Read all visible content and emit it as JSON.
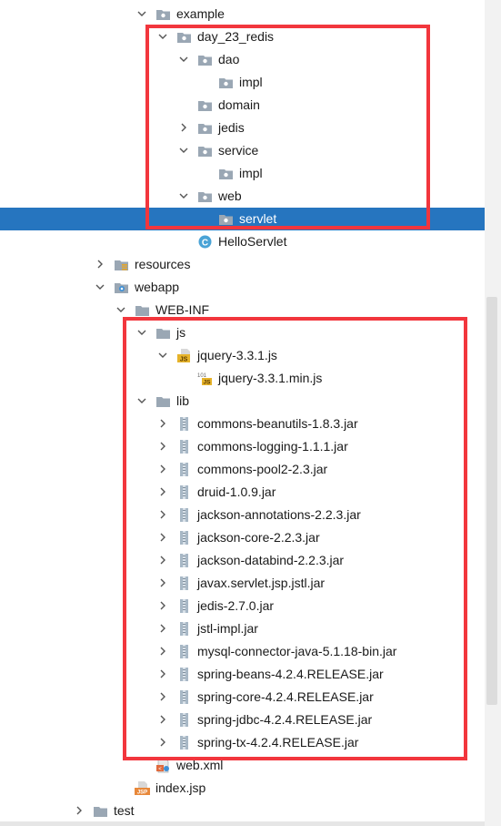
{
  "colors": {
    "selection": "#2675bf",
    "highlight_box": "#f2363d",
    "folder": "#8f9aa6"
  },
  "tree": [
    {
      "label": "example",
      "depth": 6,
      "arrow": "down",
      "icon": "package-folder-icon"
    },
    {
      "label": "day_23_redis",
      "depth": 7,
      "arrow": "down",
      "icon": "package-folder-icon"
    },
    {
      "label": "dao",
      "depth": 8,
      "arrow": "down",
      "icon": "package-folder-icon"
    },
    {
      "label": "impl",
      "depth": 9,
      "arrow": "none",
      "icon": "package-folder-icon"
    },
    {
      "label": "domain",
      "depth": 8,
      "arrow": "none",
      "icon": "package-folder-icon"
    },
    {
      "label": "jedis",
      "depth": 8,
      "arrow": "right",
      "icon": "package-folder-icon"
    },
    {
      "label": "service",
      "depth": 8,
      "arrow": "down",
      "icon": "package-folder-icon"
    },
    {
      "label": "impl",
      "depth": 9,
      "arrow": "none",
      "icon": "package-folder-icon"
    },
    {
      "label": "web",
      "depth": 8,
      "arrow": "down",
      "icon": "package-folder-icon"
    },
    {
      "label": "servlet",
      "depth": 9,
      "arrow": "none",
      "icon": "package-folder-icon",
      "selected": true
    },
    {
      "label": "HelloServlet",
      "depth": 8,
      "arrow": "none",
      "icon": "java-class-icon"
    },
    {
      "label": "resources",
      "depth": 4,
      "arrow": "right",
      "icon": "resources-folder-icon"
    },
    {
      "label": "webapp",
      "depth": 4,
      "arrow": "down",
      "icon": "web-folder-icon"
    },
    {
      "label": "WEB-INF",
      "depth": 5,
      "arrow": "down",
      "icon": "folder-icon"
    },
    {
      "label": "js",
      "depth": 6,
      "arrow": "down",
      "icon": "folder-icon"
    },
    {
      "label": "jquery-3.3.1.js",
      "depth": 7,
      "arrow": "down",
      "icon": "js-file-icon"
    },
    {
      "label": "jquery-3.3.1.min.js",
      "depth": 8,
      "arrow": "none",
      "icon": "minified-js-file-icon"
    },
    {
      "label": "lib",
      "depth": 6,
      "arrow": "down",
      "icon": "folder-icon"
    },
    {
      "label": "commons-beanutils-1.8.3.jar",
      "depth": 7,
      "arrow": "right",
      "icon": "jar-file-icon"
    },
    {
      "label": "commons-logging-1.1.1.jar",
      "depth": 7,
      "arrow": "right",
      "icon": "jar-file-icon"
    },
    {
      "label": "commons-pool2-2.3.jar",
      "depth": 7,
      "arrow": "right",
      "icon": "jar-file-icon"
    },
    {
      "label": "druid-1.0.9.jar",
      "depth": 7,
      "arrow": "right",
      "icon": "jar-file-icon"
    },
    {
      "label": "jackson-annotations-2.2.3.jar",
      "depth": 7,
      "arrow": "right",
      "icon": "jar-file-icon"
    },
    {
      "label": "jackson-core-2.2.3.jar",
      "depth": 7,
      "arrow": "right",
      "icon": "jar-file-icon"
    },
    {
      "label": "jackson-databind-2.2.3.jar",
      "depth": 7,
      "arrow": "right",
      "icon": "jar-file-icon"
    },
    {
      "label": "javax.servlet.jsp.jstl.jar",
      "depth": 7,
      "arrow": "right",
      "icon": "jar-file-icon"
    },
    {
      "label": "jedis-2.7.0.jar",
      "depth": 7,
      "arrow": "right",
      "icon": "jar-file-icon"
    },
    {
      "label": "jstl-impl.jar",
      "depth": 7,
      "arrow": "right",
      "icon": "jar-file-icon"
    },
    {
      "label": "mysql-connector-java-5.1.18-bin.jar",
      "depth": 7,
      "arrow": "right",
      "icon": "jar-file-icon"
    },
    {
      "label": "spring-beans-4.2.4.RELEASE.jar",
      "depth": 7,
      "arrow": "right",
      "icon": "jar-file-icon"
    },
    {
      "label": "spring-core-4.2.4.RELEASE.jar",
      "depth": 7,
      "arrow": "right",
      "icon": "jar-file-icon"
    },
    {
      "label": "spring-jdbc-4.2.4.RELEASE.jar",
      "depth": 7,
      "arrow": "right",
      "icon": "jar-file-icon"
    },
    {
      "label": "spring-tx-4.2.4.RELEASE.jar",
      "depth": 7,
      "arrow": "right",
      "icon": "jar-file-icon"
    },
    {
      "label": "web.xml",
      "depth": 6,
      "arrow": "none",
      "icon": "xml-file-icon"
    },
    {
      "label": "index.jsp",
      "depth": 5,
      "arrow": "none",
      "icon": "jsp-file-icon"
    },
    {
      "label": "test",
      "depth": 3,
      "arrow": "right",
      "icon": "folder-icon"
    }
  ]
}
